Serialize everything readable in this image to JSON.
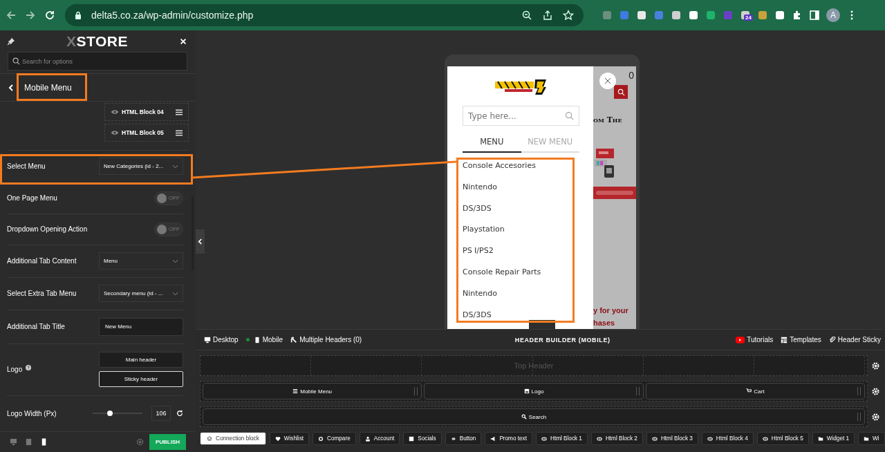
{
  "browser": {
    "url": "delta5.co.za/wp-admin/customize.php",
    "extension_badge": "24",
    "profile_initial": "A"
  },
  "sidebar": {
    "brand": {
      "prefix": "X",
      "name": "STORE"
    },
    "search": {
      "placeholder": "Search for options"
    },
    "section_title": "Mobile Menu",
    "html_blocks": [
      "HTML Block 04",
      "HTML Block 05"
    ],
    "settings": [
      {
        "kind": "select",
        "label": "Select Menu",
        "value": "New Categories (id - 2..."
      },
      {
        "kind": "toggle",
        "label": "One Page Menu",
        "on": false,
        "state_text": "OFF"
      },
      {
        "kind": "toggle",
        "label": "Dropdown Opening Action",
        "on": false,
        "state_text": "OFF"
      },
      {
        "kind": "select",
        "label": "Additional Tab Content",
        "value": "Menu"
      },
      {
        "kind": "select",
        "label": "Select Extra Tab Menu",
        "value": "Secondary menu (id - ..."
      },
      {
        "kind": "text",
        "label": "Additional Tab Title",
        "value": "New Menu"
      },
      {
        "kind": "buttons",
        "label": "Logo",
        "help": true,
        "options": [
          {
            "label": "Main header",
            "selected": false
          },
          {
            "label": "Sticky header",
            "selected": true
          }
        ]
      },
      {
        "kind": "slider",
        "label": "Logo Width (Px)",
        "level": 0.35,
        "value": "106"
      }
    ],
    "devices": [
      {
        "kind": "desktop",
        "selected": false
      },
      {
        "kind": "tablet",
        "selected": false
      },
      {
        "kind": "mobile",
        "selected": true
      }
    ],
    "publish": "PUBLISH"
  },
  "preview": {
    "menu": {
      "search_placeholder": "Type here...",
      "tabs": [
        {
          "label": "MENU",
          "selected": true
        },
        {
          "label": "NEW MENU",
          "selected": false
        }
      ],
      "items": [
        "Console Accesories",
        "Nintendo",
        "DS/3DS",
        "Playstation",
        "PS I/PS2",
        "Console Repair Parts",
        "Nintendo",
        "DS/3DS"
      ]
    },
    "page": {
      "cart_count": "0",
      "heading": "om The",
      "promo_lines": [
        "y for your",
        "hases"
      ]
    }
  },
  "builder": {
    "views": [
      {
        "label": "Desktop",
        "selected": false
      },
      {
        "label": "Mobile",
        "selected": true
      }
    ],
    "multiple_headers": "Multiple Headers (0)",
    "title": "HEADER BUILDER (MOBILE)",
    "links": [
      "Tutorials",
      "Templates",
      "Header Sticky"
    ],
    "rows": [
      {
        "kind": "empty",
        "label": "Top Header"
      },
      {
        "kind": "elements",
        "elements": [
          "Mobile Menu",
          "Logo",
          "Cart"
        ]
      },
      {
        "kind": "elements",
        "elements": [
          "Search"
        ]
      }
    ],
    "palette": [
      {
        "label": "Connection block",
        "selected": true
      },
      {
        "label": "Wishlist",
        "selected": false
      },
      {
        "label": "Compare",
        "selected": false
      },
      {
        "label": "Account",
        "selected": false
      },
      {
        "label": "Socials",
        "selected": false
      },
      {
        "label": "Button",
        "selected": false
      },
      {
        "label": "Promo text",
        "selected": false
      },
      {
        "label": "Html Block 1",
        "selected": false
      },
      {
        "label": "Html Block 2",
        "selected": false
      },
      {
        "label": "Html Block 3",
        "selected": false
      },
      {
        "label": "Html Block 4",
        "selected": false
      },
      {
        "label": "Html Block 5",
        "selected": false
      },
      {
        "label": "Widget 1",
        "selected": false
      },
      {
        "label": "Wi",
        "selected": false
      }
    ]
  }
}
